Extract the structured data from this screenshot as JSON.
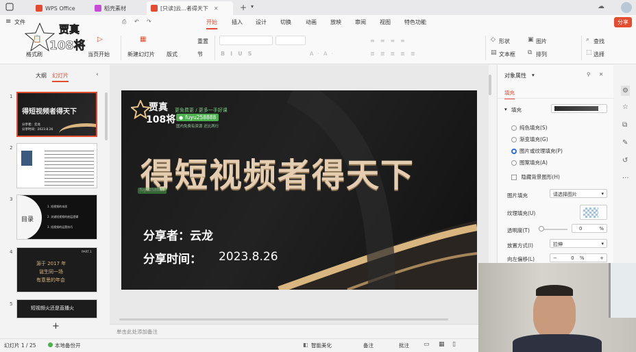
{
  "tabs": {
    "wps": "WPS Office",
    "shell": "稻壳素材",
    "doc": "[只读]云...者得天下"
  },
  "window": {
    "share": "分享"
  },
  "menu": {
    "file": "文件",
    "items": [
      "开始",
      "插入",
      "设计",
      "切换",
      "动画",
      "放映",
      "审阅",
      "视图",
      "特色功能"
    ],
    "active": "开始",
    "search": "查找"
  },
  "ribbon": {
    "format_painter": "格式刷",
    "play_from_current": "当页开始",
    "new_slide": "新建幻灯片",
    "layout": "版式",
    "reset": "重置",
    "section": "节",
    "shape": "形状",
    "picture": "图片",
    "textbox": "文本框",
    "arrange": "排列",
    "find": "查找",
    "select": "选择"
  },
  "watermark": {
    "line1": "贾真",
    "line2": "108将"
  },
  "left_panel": {
    "tab_outline": "大纲",
    "tab_slides": "幻灯片",
    "slide_numbers": [
      "1",
      "2",
      "3",
      "4",
      "5"
    ],
    "thumb1_title": "得短视频者得天下",
    "thumb1_sharer": "分享者：云龙",
    "thumb1_time": "分享时间：2023.8.26",
    "thumb3_title": "目录",
    "thumb3_items": [
      "1. 短视频的本质",
      "2. 关键短视频的底层逻辑",
      "3. 短视频的运营技巧"
    ],
    "thumb4_line1": "源于 2017 年",
    "thumb4_line2": "诞生同一场",
    "thumb4_line3": "有意思的年会",
    "thumb4_part": "PART.1",
    "thumb5_title": "短视频火还是直播火",
    "add_slide": "+"
  },
  "slide": {
    "brand1": "贾真",
    "brand2": "108将",
    "slogan": "更免费更 / 更多一手好课",
    "wechat_id": "fuyu258888",
    "subslogan": "国内免费有资源 还比两行",
    "wechat_id2": "fuyu258888",
    "title": "得短视频者得天下",
    "sharer": "分享者：云龙",
    "time_label": "分享时间：",
    "time_value": "2023.8.26"
  },
  "notes_placeholder": "单击此处添加备注",
  "right_panel": {
    "title": "对象属性",
    "tab_fill": "填充",
    "section_fill": "填充",
    "options": [
      "纯色填充(S)",
      "渐变填充(G)",
      "图片或纹理填充(P)",
      "图案填充(A)"
    ],
    "selected_option": 2,
    "hide_bg": "隐藏背景图形(H)",
    "picture_fill_label": "图片填充",
    "picture_fill_value": "请选择图片",
    "texture_label": "纹理填充(U)",
    "transparency_label": "透明度(T)",
    "transparency_value": "0",
    "transparency_unit": "%",
    "placement_label": "放置方式(I)",
    "placement_value": "拉伸",
    "offset_label": "向左偏移(L)",
    "offset_value": "0",
    "offset_unit": "%"
  },
  "status": {
    "slide_count": "幻灯片 1 / 25",
    "backup": "本地备份开",
    "beautify": "智能美化",
    "notes": "备注",
    "comment": "批注"
  },
  "colors": {
    "accent": "#e34c2f",
    "selected_blue": "#2f6fe4",
    "slide_gold": "#d9b680",
    "wechat_green": "#4caf50"
  }
}
